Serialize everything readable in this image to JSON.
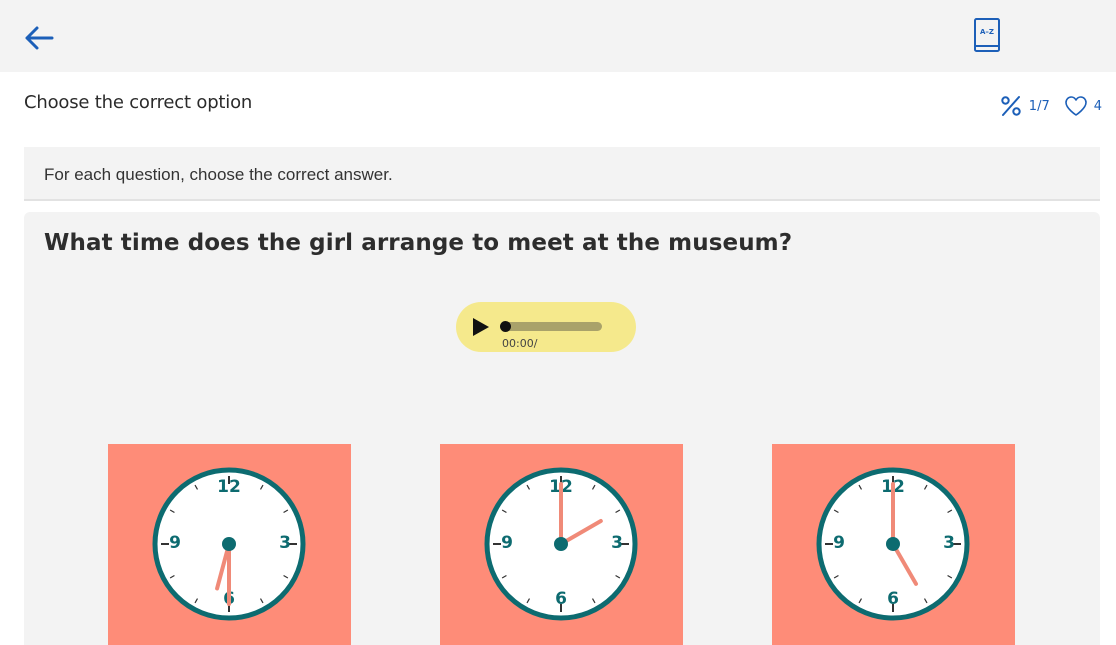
{
  "header": {
    "back_icon": "arrow-left-icon",
    "dictionary_icon": "book-a-z-icon",
    "dictionary_label": "A–Z",
    "accent_color": "#1c5fb8"
  },
  "title_row": {
    "title": "Choose the correct option",
    "progress": "1/7",
    "lives": "4"
  },
  "instructions": {
    "text": "For each question, choose the correct answer."
  },
  "question": {
    "text": "What time does the girl arrange to meet at the museum?",
    "audio": {
      "time_label": "00:00/",
      "progress_fraction": 0,
      "background_color": "#f5e98c"
    },
    "options": [
      {
        "id": "A",
        "time": "6:30",
        "hour": 6.5,
        "minute": 30
      },
      {
        "id": "B",
        "time": "2:00",
        "hour": 2,
        "minute": 0
      },
      {
        "id": "C",
        "time": "5:00",
        "hour": 5,
        "minute": 0
      }
    ],
    "clock_labels": {
      "top": "12",
      "right": "3",
      "bottom": "6",
      "left": "9"
    },
    "option_background": "#fe8c78",
    "clock_rim_color": "#0d6b70",
    "hand_color": "#f08a78"
  }
}
